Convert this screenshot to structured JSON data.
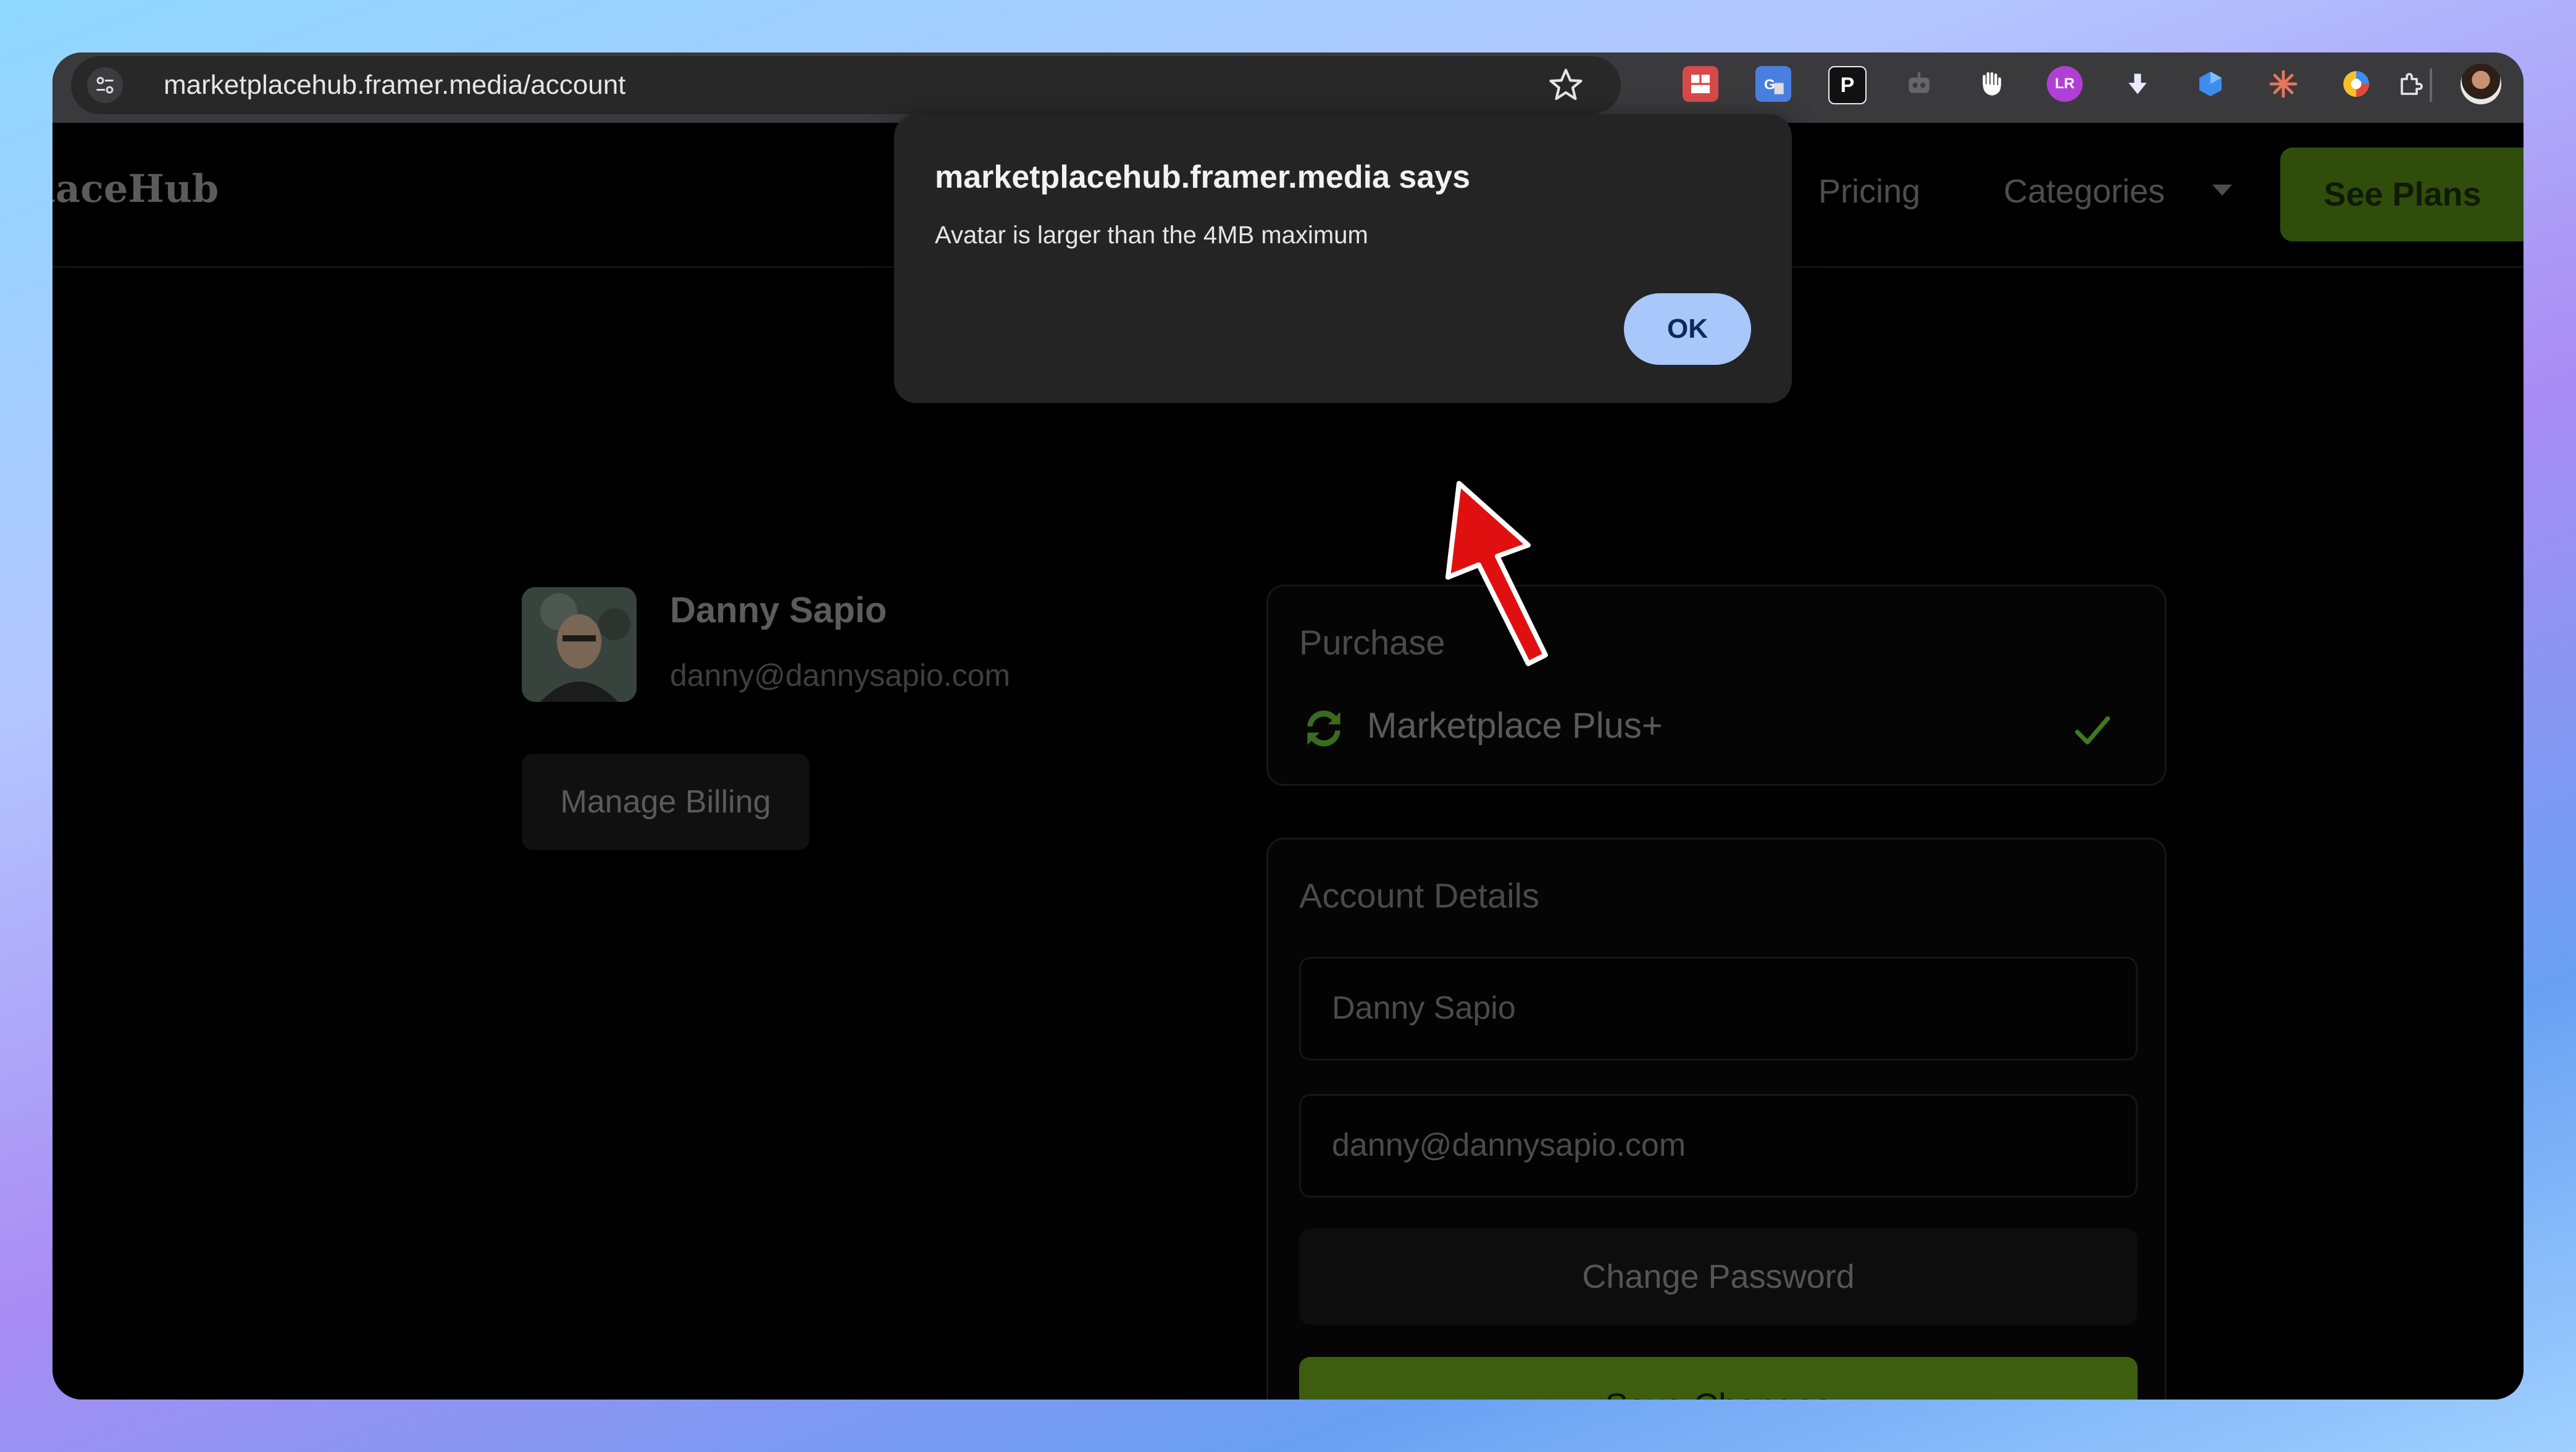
{
  "browser": {
    "url": "marketplacehub.framer.media/account",
    "extensions": [
      "todoist-icon",
      "google-translate-icon",
      "p-extension-icon",
      "robot-icon",
      "hand-icon",
      "lr-extension-icon",
      "download-arrow-icon",
      "gem-icon",
      "sparkle-icon",
      "chrome-color-icon",
      "puzzle-extensions-icon"
    ],
    "extension_letters": {
      "p": "P",
      "lr": "LR"
    }
  },
  "nav": {
    "logo": "placeHub",
    "links": [
      "Pricing",
      "Categories"
    ],
    "cta": "See Plans"
  },
  "profile": {
    "name": "Danny Sapio",
    "email": "danny@dannysapio.com",
    "manage_billing": "Manage Billing"
  },
  "purchase": {
    "heading": "Purchase",
    "plan": "Marketplace Plus+"
  },
  "account": {
    "heading": "Account Details",
    "name_value": "Danny Sapio",
    "email_value": "danny@dannysapio.com",
    "change_password": "Change Password",
    "save_changes": "Save Changes"
  },
  "dialog": {
    "title": "marketplacehub.framer.media says",
    "message": "Avatar is larger than the 4MB maximum",
    "ok": "OK"
  },
  "colors": {
    "accent_green": "#3c5e0e",
    "dialog_button": "#a8c7fa",
    "annotation_arrow": "#e01010"
  }
}
